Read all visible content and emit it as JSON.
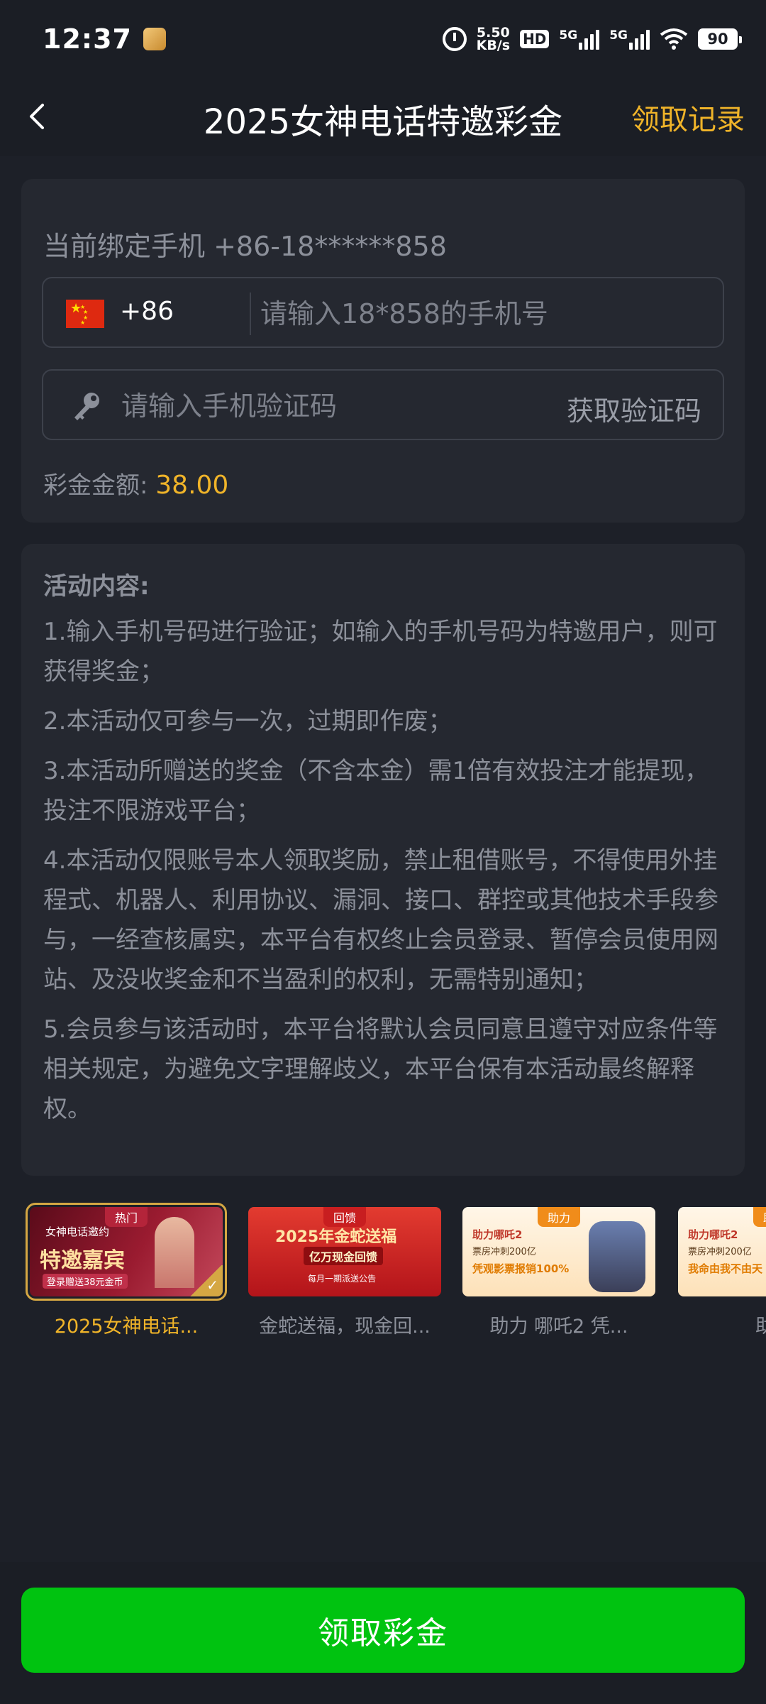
{
  "status_bar": {
    "time": "12:37",
    "net_speed_value": "5.50",
    "net_speed_unit": "KB/s",
    "hd_label": "HD",
    "sim1_label": "5G",
    "sim2_label": "5G",
    "battery": "90"
  },
  "header": {
    "title": "2025女神电话特邀彩金",
    "record_link": "领取记录"
  },
  "form": {
    "bound_phone_label": "当前绑定手机 +86-18******858",
    "country_code": "+86",
    "phone_placeholder": "请输入18*858的手机号",
    "code_placeholder": "请输入手机验证码",
    "get_code_label": "获取验证码",
    "amount_label": "彩金金额: ",
    "amount_value": "38.00"
  },
  "rules": {
    "title": "活动内容:",
    "items": [
      "1.输入手机号码进行验证；如输入的手机号码为特邀用户，则可获得奖金；",
      "2.本活动仅可参与一次，过期即作废；",
      "3.本活动所赠送的奖金（不含本金）需1倍有效投注才能提现，投注不限游戏平台；",
      "4.本活动仅限账号本人领取奖励，禁止租借账号，不得使用外挂程式、机器人、利用协议、漏洞、接口、群控或其他技术手段参与，一经查核属实，本平台有权终止会员登录、暂停会员使用网站、及没收奖金和不当盈利的权利，无需特别通知；",
      "5.会员参与该活动时，本平台将默认会员同意且遵守对应条件等相关规定，为避免文字理解歧义，本平台保有本活动最终解释权。"
    ]
  },
  "promos": [
    {
      "label": "2025女神电话...",
      "tag": "热门",
      "line1": "女神电话邀约",
      "line2": "特邀嘉宾",
      "line3": "登录赠送38元金币"
    },
    {
      "label": "金蛇送福，现金回...",
      "tag": "回馈",
      "line1": "2025年金蛇送福",
      "line2": "亿万现金回馈",
      "line3": "每月一期派送公告"
    },
    {
      "label": "助力 哪吒2 凭...",
      "tag": "助力",
      "line1": "助力哪吒2",
      "line2": "票房冲刺200亿",
      "line3": "凭观影票报销100%"
    },
    {
      "label": "助力",
      "tag": "助力",
      "line1": "助力哪吒2",
      "line2": "票房冲刺200亿",
      "line3": "我命由我不由天"
    }
  ],
  "claim_button": "领取彩金",
  "colors": {
    "accent_gold": "#f0b429",
    "primary_green": "#00c310",
    "background": "#1d2028",
    "card": "#252830"
  }
}
